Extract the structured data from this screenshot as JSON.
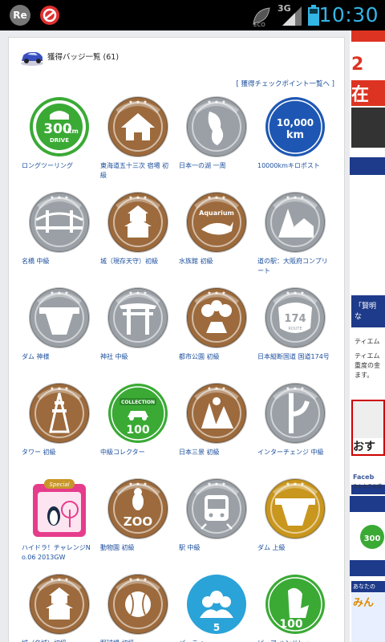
{
  "status": {
    "app1": "Re",
    "network": "3G",
    "time": "10:30"
  },
  "header": {
    "title": "獲得バッジ一覧 (61)",
    "list_link": "[ 獲得チェックポイント一覧へ ]"
  },
  "badges": [
    {
      "label": "ロングツーリング",
      "icon": "300km-drive-icon",
      "color": "#3aaa35",
      "text1": "300",
      "text2": "km",
      "text3": "DRIVE"
    },
    {
      "label": "東海道五十三次 宿場 初級",
      "icon": "post-town-icon",
      "color": "#9c6a3c"
    },
    {
      "label": "日本一の湖 一周",
      "icon": "lake-biwa-icon",
      "color": "#9aa0a6"
    },
    {
      "label": "10000kmキロポスト",
      "icon": "10000km-icon",
      "color": "#1e57b3",
      "text1": "10,000",
      "text2": "km"
    },
    {
      "label": "名橋 中級",
      "icon": "bridge-icon",
      "color": "#9aa0a6"
    },
    {
      "label": "城（現存天守）初級",
      "icon": "castle-icon",
      "color": "#9c6a3c"
    },
    {
      "label": "水族館 初級",
      "icon": "aquarium-icon",
      "color": "#9c6a3c",
      "text1": "Aquarium"
    },
    {
      "label": "道の駅：大阪府コンプリート",
      "icon": "roadside-station-icon",
      "color": "#9aa0a6"
    },
    {
      "label": "ダム 神様",
      "icon": "dam-icon",
      "color": "#9aa0a6"
    },
    {
      "label": "神社 中級",
      "icon": "shrine-icon",
      "color": "#9aa0a6"
    },
    {
      "label": "都市公園 初級",
      "icon": "park-icon",
      "color": "#9c6a3c"
    },
    {
      "label": "日本縦断国道 国道174号",
      "icon": "route-174-icon",
      "color": "#9aa0a6",
      "text1": "174",
      "text2": "ROUTE"
    },
    {
      "label": "タワー 初級",
      "icon": "tower-icon",
      "color": "#9c6a3c"
    },
    {
      "label": "中級コレクター",
      "icon": "collection-icon",
      "color": "#3aaa35",
      "text1": "COLLECTION",
      "text2": "100"
    },
    {
      "label": "日本三景 初級",
      "icon": "scenic-spot-icon",
      "color": "#9c6a3c"
    },
    {
      "label": "インターチェンジ 中級",
      "icon": "interchange-icon",
      "color": "#9aa0a6"
    },
    {
      "label": "ハイドラ！チャレンジNo.06 2013GW",
      "icon": "special-penguin-icon",
      "color": "#e63c8c",
      "text1": "Special"
    },
    {
      "label": "動物園 初級",
      "icon": "zoo-icon",
      "color": "#9c6a3c",
      "text1": "ZOO"
    },
    {
      "label": "駅 中級",
      "icon": "station-icon",
      "color": "#9aa0a6"
    },
    {
      "label": "ダム 上級",
      "icon": "dam-gold-icon",
      "color": "#c9961e"
    },
    {
      "label": "城（名城）初級",
      "icon": "castle-icon",
      "color": "#9c6a3c"
    },
    {
      "label": "野球場 初級",
      "icon": "baseball-icon",
      "color": "#9c6a3c"
    },
    {
      "label": "パーティー",
      "icon": "party-icon",
      "color": "#2aa3d8",
      "text1": "5"
    },
    {
      "label": "ピュア ハンドレッ",
      "icon": "pure-hundred-icon",
      "color": "#3aaa35",
      "text1": "100"
    }
  ],
  "sidebar": {
    "ad_text": "在庫",
    "quote": "「賢明な",
    "item1": "ティエム",
    "item2": "ティエム",
    "item3": "重度の金",
    "item4": "ます。",
    "ad2": "おす",
    "fb": "Faceb",
    "fb2": "みんカラ公式",
    "km300": "300",
    "ad3": "あなたの",
    "ad3b": "みん"
  }
}
